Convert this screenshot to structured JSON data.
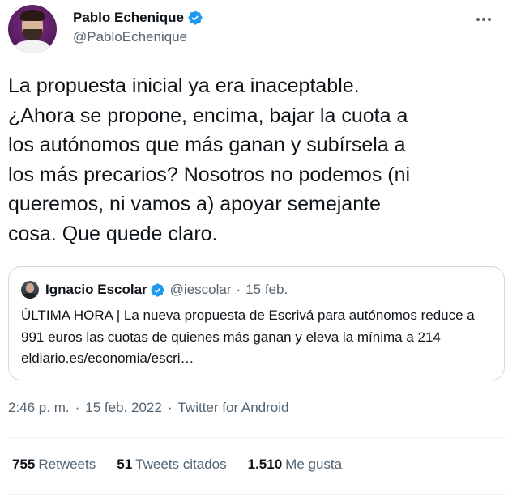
{
  "author": {
    "name": "Pablo Echenique",
    "handle": "@PabloEchenique",
    "verified": true,
    "avatar_icon": "profile-photo"
  },
  "tweet": {
    "text": "La propuesta inicial ya era inaceptable.\n¿Ahora se propone, encima, bajar la cuota a\nlos autónomos que más ganan y subírsela a\nlos más precarios? Nosotros no podemos (ni\nqueremos, ni vamos a) apoyar semejante\ncosa. Que quede claro."
  },
  "quoted": {
    "name": "Ignacio Escolar",
    "handle": "@iescolar",
    "dot": "·",
    "date": "15 feb.",
    "verified": true,
    "text": "ÚLTIMA HORA | La nueva propuesta de Escrivá para autónomos reduce a 991 euros las cuotas de quienes más ganan y eleva la mínima a 214 eldiario.es/economia/escri…"
  },
  "meta": {
    "time": "2:46 p. m.",
    "sep1": "·",
    "date": "15 feb. 2022",
    "sep2": "·",
    "source": "Twitter for Android"
  },
  "stats": {
    "retweets_count": "755",
    "retweets_label": "Retweets",
    "quotes_count": "51",
    "quotes_label": "Tweets citados",
    "likes_count": "1.510",
    "likes_label": "Me gusta"
  },
  "colors": {
    "verified": "#1d9bf0",
    "secondary_text": "#536471",
    "border": "#cfd9de"
  }
}
